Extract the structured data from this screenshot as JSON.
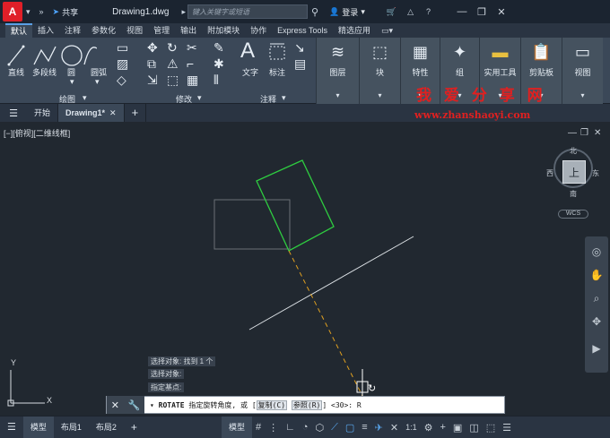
{
  "titlebar": {
    "logo": "A",
    "share_label": "共享",
    "doc_title": "Drawing1.dwg",
    "search_placeholder": "键入关键字或短语",
    "login_label": "登录"
  },
  "menu_tabs": [
    "默认",
    "插入",
    "注释",
    "参数化",
    "视图",
    "管理",
    "输出",
    "附加模块",
    "协作",
    "Express Tools",
    "精选应用"
  ],
  "ribbon": {
    "draw_tools": [
      "直线",
      "多段线",
      "圆",
      "圆弧"
    ],
    "draw_panel": "绘图",
    "modify_panel": "修改",
    "text_label": "文字",
    "dimension_label": "标注",
    "annotation_panel": "注释",
    "layer_label": "图层",
    "block_label": "块",
    "properties_label": "特性",
    "group_label": "组",
    "utilities_label": "实用工具",
    "clipboard_label": "剪贴板",
    "view_label": "视图"
  },
  "watermark": {
    "cn": "我 爱 分 享 网",
    "url": "www.zhanshaoyi.com"
  },
  "file_tabs": {
    "start": "开始",
    "drawing": "Drawing1*"
  },
  "viewport": {
    "label": "[−][俯视][二维线框]",
    "compass_n": "北",
    "compass_s": "南",
    "compass_e": "东",
    "compass_w": "西",
    "cube_face": "上",
    "wcs": "WCS"
  },
  "command": {
    "history": [
      "选择对象: 找到 1 个",
      "选择对象:",
      "指定基点:"
    ],
    "cmd_name": "ROTATE",
    "prompt": "指定旋转角度, 或 [",
    "opt_copy": "复制(C)",
    "opt_ref": "参照(R)",
    "tail": "] <30>:  R"
  },
  "status": {
    "tab_model": "模型",
    "tab_layout1": "布局1",
    "tab_layout2": "布局2",
    "model_btn": "模型",
    "scale": "1:1"
  },
  "colors": {
    "accent": "#5aa0e6",
    "rotated_rect": "#2ecc40",
    "rubber_band": "#e0a020",
    "watermark": "#e02020"
  }
}
